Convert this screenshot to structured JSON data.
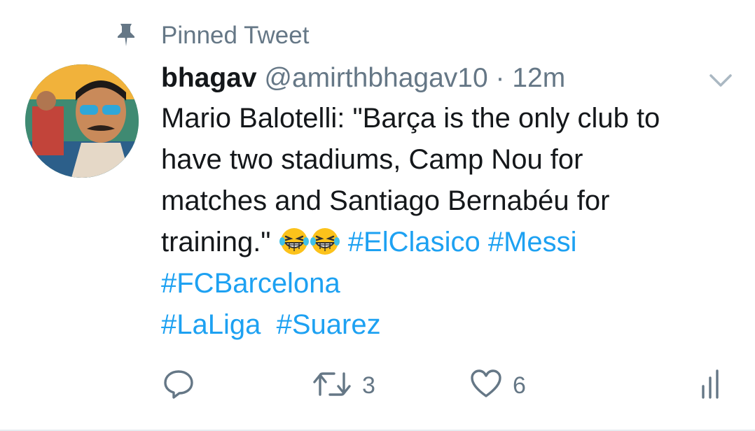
{
  "pinned": {
    "label": "Pinned Tweet",
    "icon": "pin-icon"
  },
  "author": {
    "display_name": "bhagav",
    "handle": "@amirthbhagav10",
    "separator": "·",
    "time": "12m"
  },
  "tweet": {
    "line1": "Mario Balotelli: \"Barça is the only club to",
    "line2": "have two stadiums, Camp Nou for",
    "line3": "matches and Santiago Bernabéu for",
    "line4_prefix": "training.\"",
    "emoji": "grinning-squinting-tears-emoji",
    "hashtags": [
      "#ElClasico",
      "#Messi",
      "#FCBarcelona",
      "#LaLiga",
      "#Suarez"
    ]
  },
  "actions": {
    "reply_icon": "reply-icon",
    "retweet_icon": "retweet-icon",
    "retweet_count": "3",
    "like_icon": "heart-icon",
    "like_count": "6",
    "analytics_icon": "analytics-icon"
  },
  "colors": {
    "link": "#1da1f2",
    "muted": "#657786",
    "text": "#14171a"
  }
}
